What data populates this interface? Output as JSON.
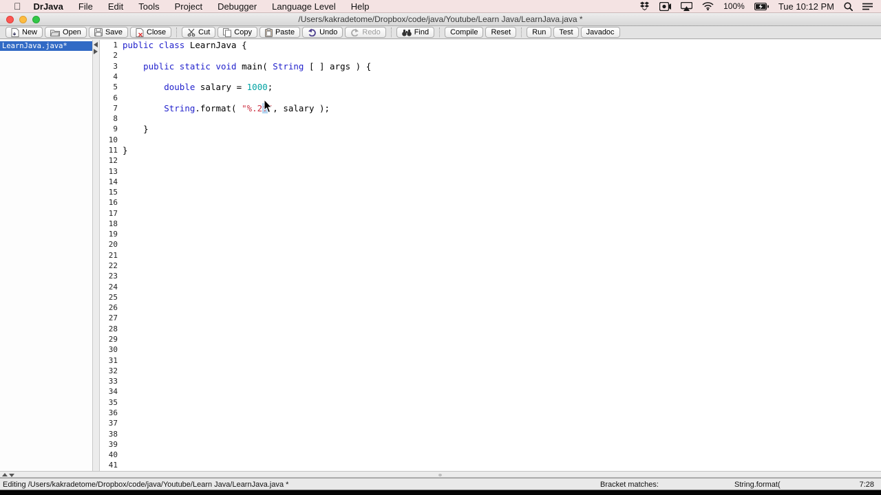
{
  "menu_bar": {
    "apple_logo": "",
    "items": [
      "DrJava",
      "File",
      "Edit",
      "Tools",
      "Project",
      "Debugger",
      "Language Level",
      "Help"
    ],
    "battery_percent": "100%",
    "clock": "Tue 10:12 PM"
  },
  "window": {
    "title": "/Users/kakradetome/Dropbox/code/java/Youtube/Learn Java/LearnJava.java *"
  },
  "toolbar": {
    "groups": [
      [
        {
          "label": "New",
          "icon": "new-document-icon",
          "enabled": true
        },
        {
          "label": "Open",
          "icon": "open-folder-icon",
          "enabled": true
        },
        {
          "label": "Save",
          "icon": "save-disk-icon",
          "enabled": true
        },
        {
          "label": "Close",
          "icon": "close-document-icon",
          "enabled": true
        }
      ],
      [
        {
          "label": "Cut",
          "icon": "cut-scissors-icon",
          "enabled": true
        },
        {
          "label": "Copy",
          "icon": "copy-pages-icon",
          "enabled": true
        },
        {
          "label": "Paste",
          "icon": "paste-clipboard-icon",
          "enabled": true
        },
        {
          "label": "Undo",
          "icon": "undo-arrow-icon",
          "enabled": true
        },
        {
          "label": "Redo",
          "icon": "redo-arrow-icon",
          "enabled": false
        }
      ],
      [
        {
          "label": "Find",
          "icon": "find-binoculars-icon",
          "enabled": true
        }
      ],
      [
        {
          "label": "Compile",
          "icon": "",
          "enabled": true
        },
        {
          "label": "Reset",
          "icon": "",
          "enabled": true
        }
      ],
      [
        {
          "label": "Run",
          "icon": "",
          "enabled": true
        },
        {
          "label": "Test",
          "icon": "",
          "enabled": true
        },
        {
          "label": "Javadoc",
          "icon": "",
          "enabled": true
        }
      ]
    ]
  },
  "sidebar": {
    "files": [
      {
        "name": "LearnJava.java*",
        "selected": true
      }
    ]
  },
  "editor": {
    "visible_line_count": 41,
    "lines": {
      "1": [
        {
          "c": "kw",
          "t": "public class"
        },
        {
          "c": "plain",
          "t": " LearnJava {"
        }
      ],
      "3": [
        {
          "c": "plain",
          "t": "    "
        },
        {
          "c": "kw",
          "t": "public static void"
        },
        {
          "c": "plain",
          "t": " main( "
        },
        {
          "c": "kw",
          "t": "String"
        },
        {
          "c": "plain",
          "t": " [ ] args ) {"
        }
      ],
      "5": [
        {
          "c": "plain",
          "t": "        "
        },
        {
          "c": "kw",
          "t": "double"
        },
        {
          "c": "plain",
          "t": " salary = "
        },
        {
          "c": "num",
          "t": "1000"
        },
        {
          "c": "plain",
          "t": ";"
        }
      ],
      "7": [
        {
          "c": "plain",
          "t": "        "
        },
        {
          "c": "kw",
          "t": "String"
        },
        {
          "c": "plain",
          "t": ".format( "
        },
        {
          "c": "str",
          "t": "\"%.2"
        },
        {
          "c": "str sel",
          "t": "f"
        },
        {
          "c": "str",
          "t": "\""
        },
        {
          "c": "plain",
          "t": ", salary );"
        }
      ],
      "9": [
        {
          "c": "plain",
          "t": "    }"
        }
      ],
      "11": [
        {
          "c": "plain",
          "t": "}"
        }
      ]
    }
  },
  "status_bar": {
    "left_text": "Editing /Users/kakradetome/Dropbox/code/java/Youtube/Learn Java/LearnJava.java *",
    "bracket_label": "Bracket matches:",
    "bracket_value": "String.format(",
    "caret_position": "7:28"
  },
  "colors": {
    "keyword": "#2222cc",
    "number": "#00a3a3",
    "string": "#cc3344",
    "selection": "#b4d5f0",
    "sidebar_selection": "#316ac5",
    "menubar_bg": "#f4e3e3"
  }
}
